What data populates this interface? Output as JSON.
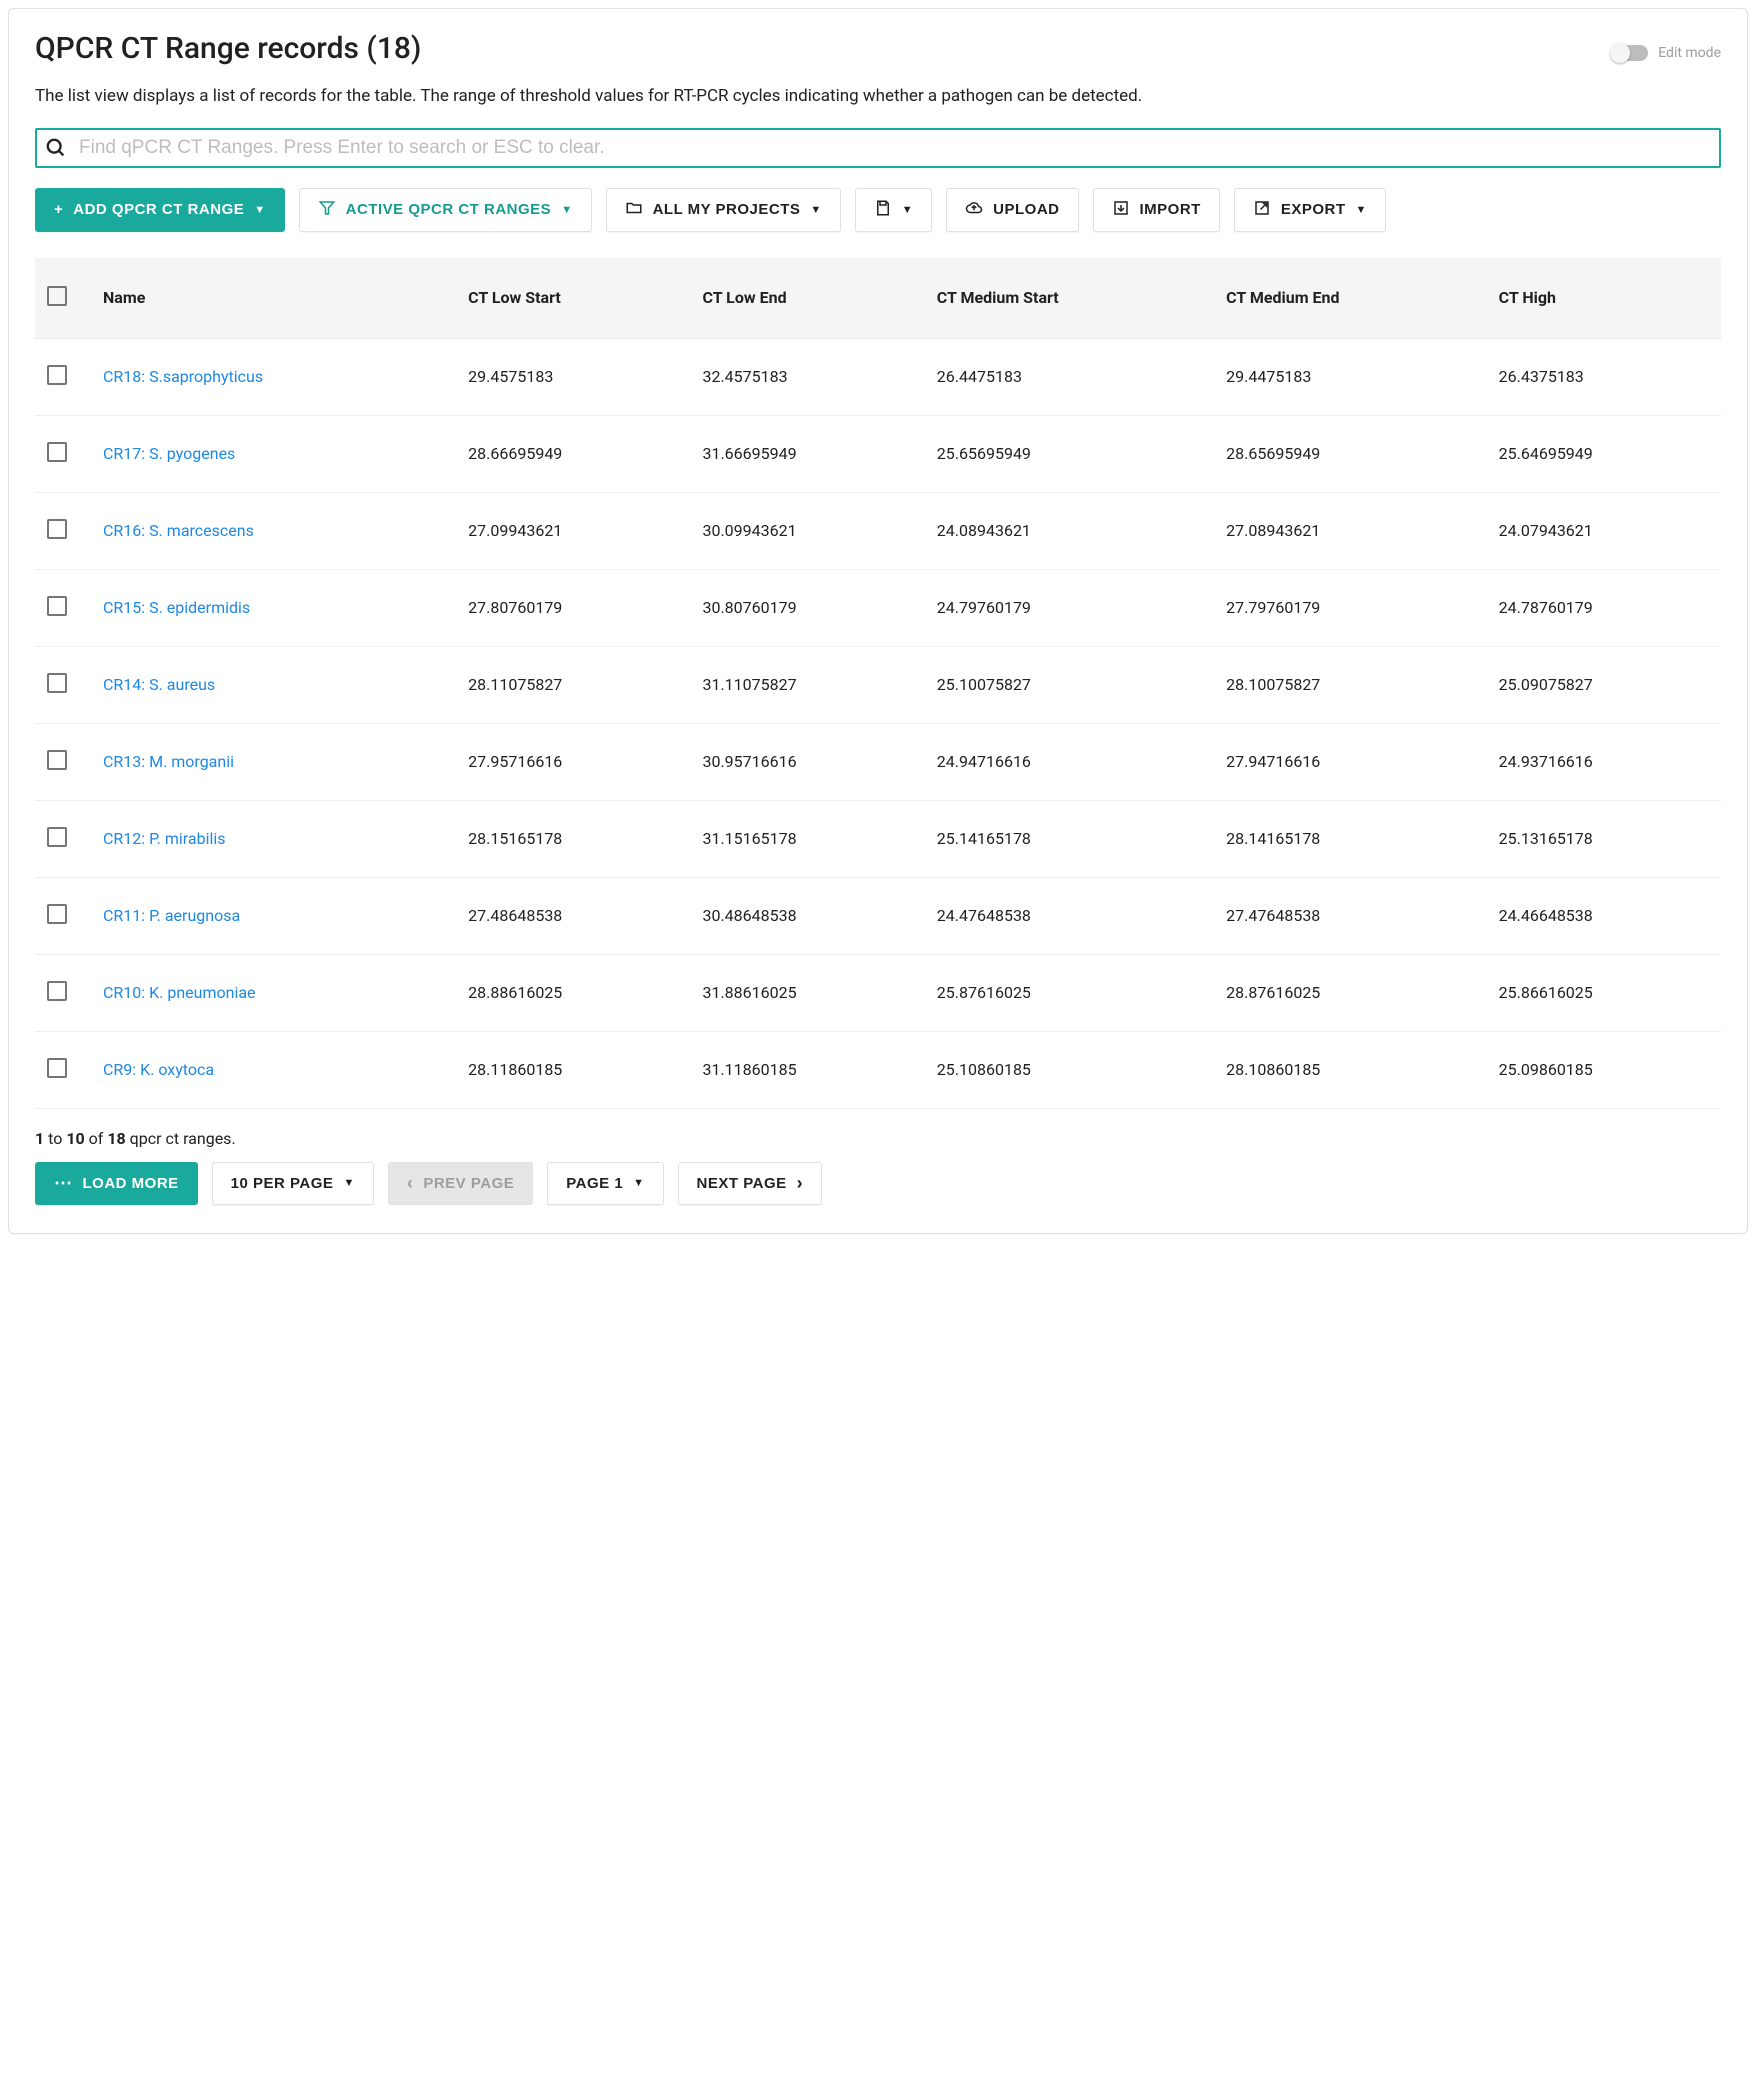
{
  "header": {
    "title": "QPCR CT Range records (18)",
    "edit_mode_label": "Edit mode"
  },
  "subtitle": "The list view displays a list of records for the table. The range of threshold values for RT-PCR cycles indicating whether a pathogen can be detected.",
  "search": {
    "placeholder": "Find qPCR CT Ranges. Press Enter to search or ESC to clear."
  },
  "toolbar": {
    "add_label": "Add qPCR CT Range",
    "active_label": "Active qPCR CT Ranges",
    "projects_label": "All My Projects",
    "upload_label": "Upload",
    "import_label": "Import",
    "export_label": "Export"
  },
  "table": {
    "columns": {
      "name": "Name",
      "ct_low_start": "CT Low Start",
      "ct_low_end": "CT Low End",
      "ct_medium_start": "CT Medium Start",
      "ct_medium_end": "CT Medium End",
      "ct_high": "CT High"
    },
    "rows": [
      {
        "name": "CR18: S.saprophyticus",
        "ct_low_start": "29.4575183",
        "ct_low_end": "32.4575183",
        "ct_medium_start": "26.4475183",
        "ct_medium_end": "29.4475183",
        "ct_high": "26.4375183"
      },
      {
        "name": "CR17: S. pyogenes",
        "ct_low_start": "28.66695949",
        "ct_low_end": "31.66695949",
        "ct_medium_start": "25.65695949",
        "ct_medium_end": "28.65695949",
        "ct_high": "25.64695949"
      },
      {
        "name": "CR16: S. marcescens",
        "ct_low_start": "27.09943621",
        "ct_low_end": "30.09943621",
        "ct_medium_start": "24.08943621",
        "ct_medium_end": "27.08943621",
        "ct_high": "24.07943621"
      },
      {
        "name": "CR15: S. epidermidis",
        "ct_low_start": "27.80760179",
        "ct_low_end": "30.80760179",
        "ct_medium_start": "24.79760179",
        "ct_medium_end": "27.79760179",
        "ct_high": "24.78760179"
      },
      {
        "name": "CR14: S. aureus",
        "ct_low_start": "28.11075827",
        "ct_low_end": "31.11075827",
        "ct_medium_start": "25.10075827",
        "ct_medium_end": "28.10075827",
        "ct_high": "25.09075827"
      },
      {
        "name": "CR13: M. morganii",
        "ct_low_start": "27.95716616",
        "ct_low_end": "30.95716616",
        "ct_medium_start": "24.94716616",
        "ct_medium_end": "27.94716616",
        "ct_high": "24.93716616"
      },
      {
        "name": "CR12: P. mirabilis",
        "ct_low_start": "28.15165178",
        "ct_low_end": "31.15165178",
        "ct_medium_start": "25.14165178",
        "ct_medium_end": "28.14165178",
        "ct_high": "25.13165178"
      },
      {
        "name": "CR11: P. aerugnosa",
        "ct_low_start": "27.48648538",
        "ct_low_end": "30.48648538",
        "ct_medium_start": "24.47648538",
        "ct_medium_end": "27.47648538",
        "ct_high": "24.46648538"
      },
      {
        "name": "CR10: K. pneumoniae",
        "ct_low_start": "28.88616025",
        "ct_low_end": "31.88616025",
        "ct_medium_start": "25.87616025",
        "ct_medium_end": "28.87616025",
        "ct_high": "25.86616025"
      },
      {
        "name": "CR9: K. oxytoca",
        "ct_low_start": "28.11860185",
        "ct_low_end": "31.11860185",
        "ct_medium_start": "25.10860185",
        "ct_medium_end": "28.10860185",
        "ct_high": "25.09860185"
      }
    ]
  },
  "pagination": {
    "summary_prefix": "1",
    "summary_to": " to ",
    "summary_mid": "10",
    "summary_of": " of ",
    "summary_total": "18",
    "summary_suffix": " qpcr ct ranges.",
    "load_more": "Load More",
    "per_page": "10 per page",
    "prev": "Prev Page",
    "page": "Page 1",
    "next": "Next Page"
  }
}
